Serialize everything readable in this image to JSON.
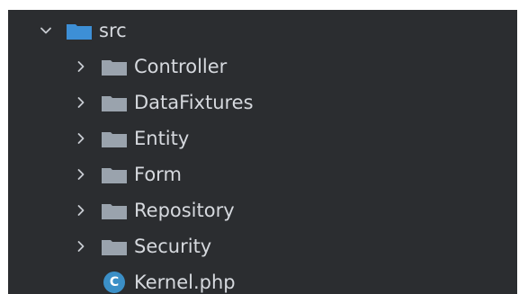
{
  "tree": {
    "root": {
      "label": "src",
      "expanded": true,
      "icon": "folder-source-icon",
      "icon_color": "#3d8fd6"
    },
    "folders": [
      {
        "label": "Controller",
        "expanded": false,
        "icon": "folder-icon"
      },
      {
        "label": "DataFixtures",
        "expanded": false,
        "icon": "folder-icon"
      },
      {
        "label": "Entity",
        "expanded": false,
        "icon": "folder-icon"
      },
      {
        "label": "Form",
        "expanded": false,
        "icon": "folder-icon"
      },
      {
        "label": "Repository",
        "expanded": false,
        "icon": "folder-icon"
      },
      {
        "label": "Security",
        "expanded": false,
        "icon": "folder-icon"
      }
    ],
    "files": [
      {
        "label": "Kernel.php",
        "icon": "php-class-icon",
        "badge": "C",
        "badge_color": "#3b8fc7"
      }
    ]
  },
  "colors": {
    "panel_background": "#2b2d30",
    "text": "#d6d9de",
    "folder": "#9aa3ad",
    "chevron": "#c7cbd1"
  }
}
